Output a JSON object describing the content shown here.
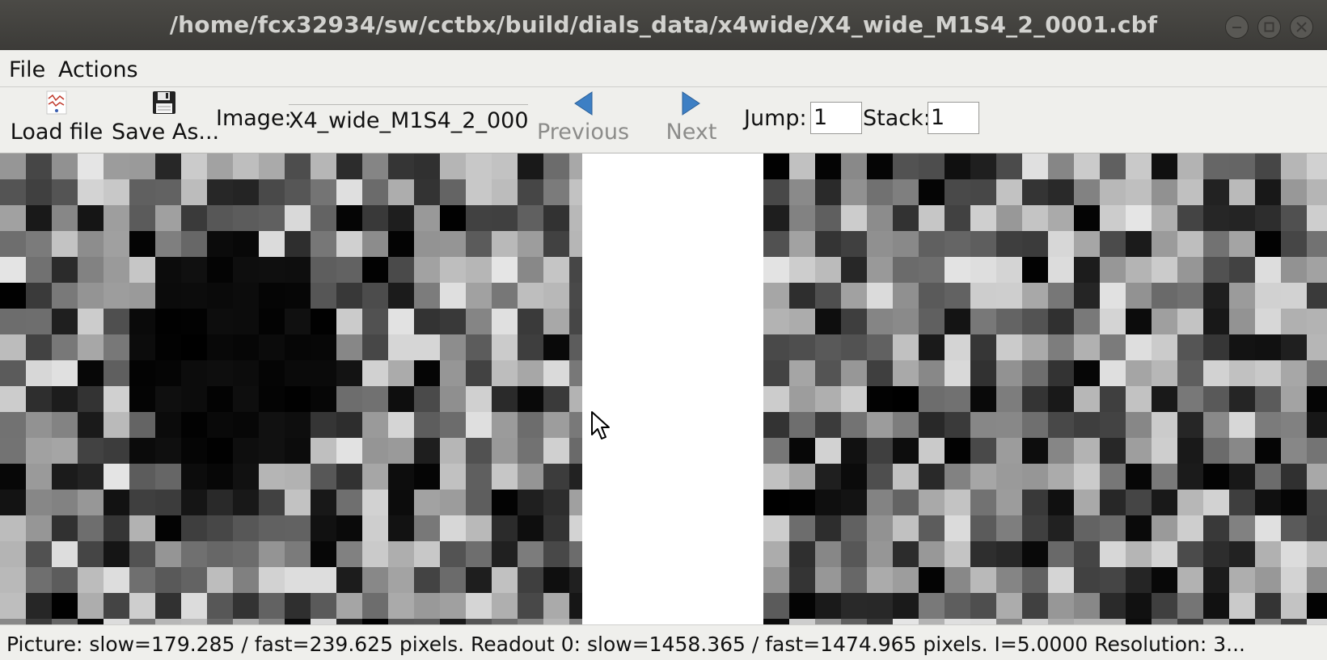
{
  "window": {
    "title": "/home/fcx32934/sw/cctbx/build/dials_data/x4wide/X4_wide_M1S4_2_0001.cbf",
    "controls": [
      "minimize-icon",
      "maximize-icon",
      "close-icon"
    ]
  },
  "menu": {
    "file": "File",
    "actions": "Actions"
  },
  "toolbar": {
    "load_label": "Load file",
    "save_label": "Save As...",
    "image_label": "Image:",
    "image_value": "X4_wide_M1S4_2_000",
    "prev_label": "Previous",
    "next_label": "Next",
    "jump_label": "Jump:",
    "jump_value": "1",
    "stack_label": "Stack:",
    "stack_value": "1",
    "icons": {
      "load": "plot-icon",
      "save": "floppy-disk-icon",
      "prev": "arrow-left-icon",
      "next": "arrow-right-icon"
    },
    "arrow_color": "#3d7fc4"
  },
  "status": {
    "text": "Picture:  slow=179.285 / fast=239.625 pixels. Readout 0: slow=1458.365 / fast=1474.965 pixels. I=5.0000 Resolution: 3..."
  }
}
